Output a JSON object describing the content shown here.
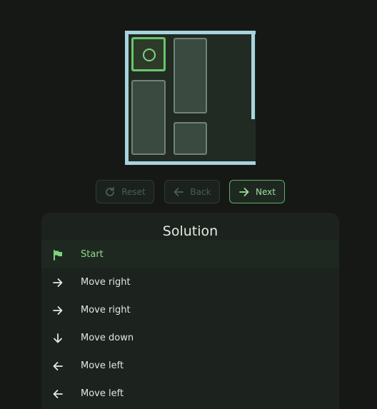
{
  "controls": {
    "reset_label": "Reset",
    "back_label": "Back",
    "next_label": "Next"
  },
  "solution": {
    "title": "Solution",
    "steps": [
      {
        "label": "Start",
        "icon": "flag-icon"
      },
      {
        "label": "Move right",
        "icon": "arrow-right-icon"
      },
      {
        "label": "Move right",
        "icon": "arrow-right-icon"
      },
      {
        "label": "Move down",
        "icon": "arrow-down-icon"
      },
      {
        "label": "Move left",
        "icon": "arrow-left-icon"
      },
      {
        "label": "Move left",
        "icon": "arrow-left-icon"
      }
    ],
    "current_step": 0
  },
  "colors": {
    "wall": "#a7d3dc",
    "accent": "#69c66a",
    "block": "#3a4a41"
  }
}
